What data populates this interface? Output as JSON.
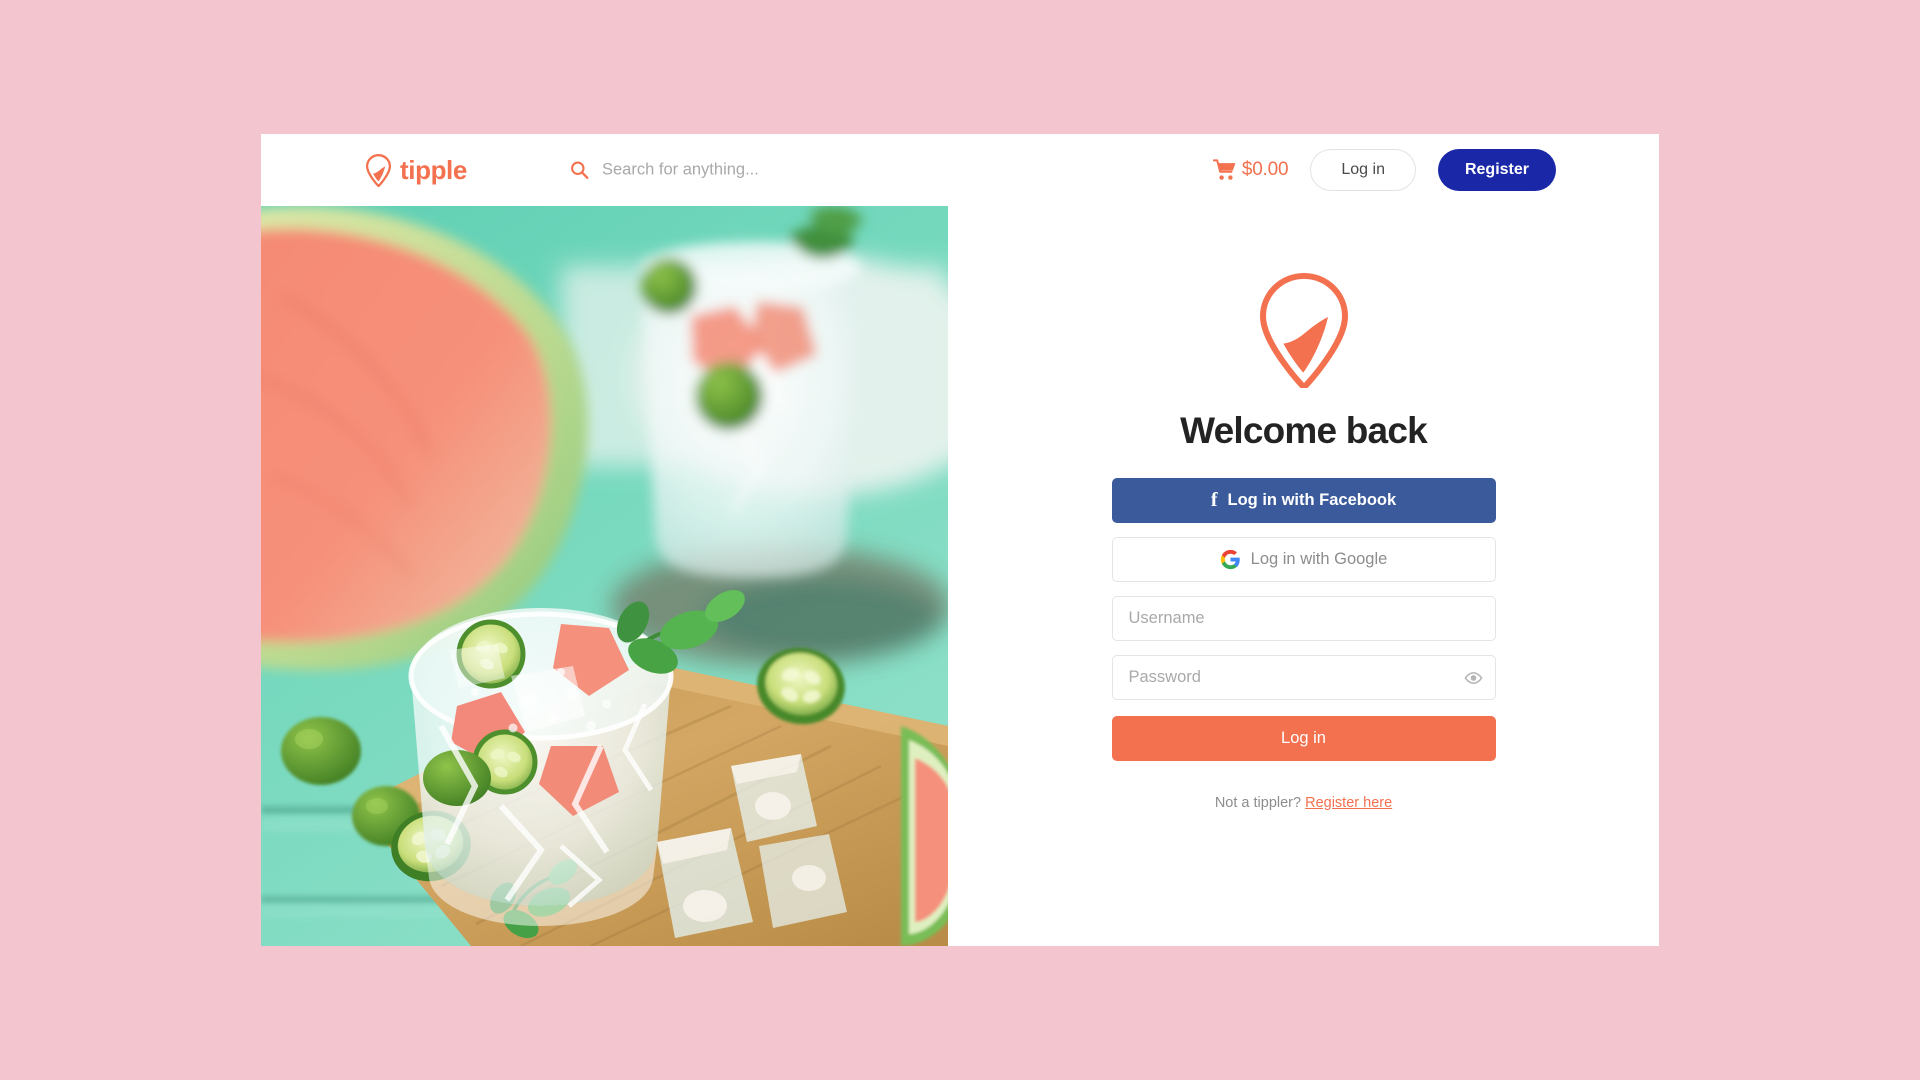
{
  "background_color": "#f3c5ce",
  "brand": {
    "accent_color": "#f3714f",
    "logo_text": "tipple",
    "logo_icon": "tipple-pin-icon"
  },
  "header": {
    "search": {
      "icon": "search-icon",
      "placeholder": "Search for anything...",
      "value": ""
    },
    "cart": {
      "icon": "shopping-cart-icon",
      "total": "$0.00"
    },
    "login_label": "Log in",
    "register_label": "Register",
    "register_color": "#1a28a8"
  },
  "hero": {
    "image_alt": "watermelon cocktail with lime, mint and ice on wooden board"
  },
  "login": {
    "pin_icon": "tipple-pin-icon",
    "heading": "Welcome back",
    "facebook": {
      "label": "Log in with Facebook",
      "icon": "facebook-icon",
      "color": "#3b5a9b"
    },
    "google": {
      "label": "Log in with Google",
      "icon": "google-icon"
    },
    "username": {
      "placeholder": "Username",
      "value": ""
    },
    "password": {
      "placeholder": "Password",
      "value": "",
      "toggle_icon": "eye-icon"
    },
    "submit_label": "Log in",
    "submit_color": "#f3714f",
    "footnote_text": "Not a tippler?",
    "footnote_link": "Register here"
  }
}
